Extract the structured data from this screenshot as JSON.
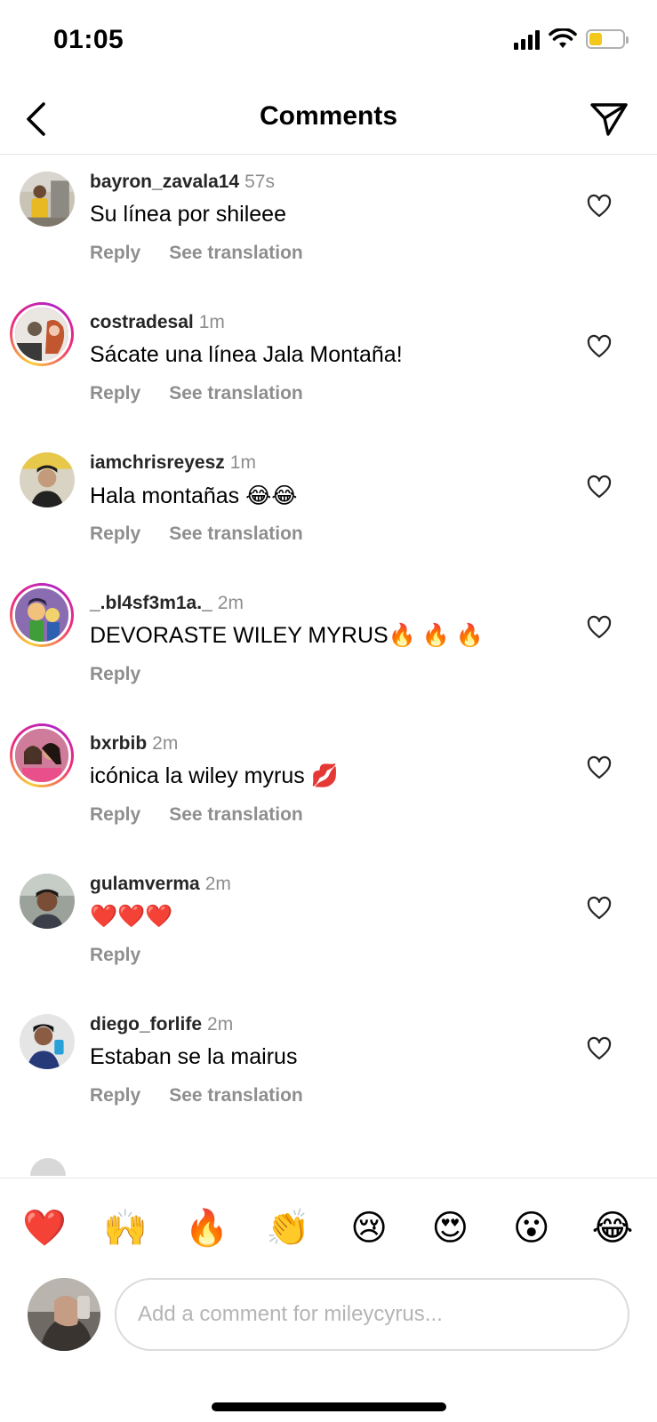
{
  "status_bar": {
    "time": "01:05",
    "battery_color": "#f4c71b",
    "battery_level": 0.4
  },
  "header": {
    "title": "Comments",
    "back_icon": "chevron-left-icon",
    "send_icon": "paper-plane-icon"
  },
  "comments": [
    {
      "username": "bayron_zavala14",
      "time": "57s",
      "text": "Su línea por shileee",
      "reply": "Reply",
      "translate": "See translation",
      "story_ring": false
    },
    {
      "username": "costradesal",
      "time": "1m",
      "text": "Sácate una línea Jala Montaña!",
      "reply": "Reply",
      "translate": "See translation",
      "story_ring": true
    },
    {
      "username": "iamchrisreyesz",
      "time": "1m",
      "text": "Hala montañas 😂😂",
      "reply": "Reply",
      "translate": "See translation",
      "story_ring": false
    },
    {
      "username": "_.bl4sf3m1a._",
      "time": "2m",
      "text": "DEVORASTE WILEY MYRUS🔥 🔥 🔥",
      "reply": "Reply",
      "translate": "",
      "story_ring": true
    },
    {
      "username": "bxrbib",
      "time": "2m",
      "text": "icónica la wiley myrus 💋",
      "reply": "Reply",
      "translate": "See translation",
      "story_ring": true
    },
    {
      "username": "gulamverma",
      "time": "2m",
      "text": "❤️❤️❤️",
      "reply": "Reply",
      "translate": "",
      "story_ring": false
    },
    {
      "username": "diego_forlife",
      "time": "2m",
      "text": "Estaban se la mairus",
      "reply": "Reply",
      "translate": "See translation",
      "story_ring": false
    }
  ],
  "emoji_bar": [
    "❤️",
    "🙌",
    "🔥",
    "👏",
    "😢",
    "😍",
    "😮",
    "😂"
  ],
  "composer": {
    "placeholder": "Add a comment for mileycyrus..."
  },
  "colors": {
    "muted_text": "#8e8e8e",
    "divider": "#e6e6e6",
    "story_ring_start": "#f9ce34",
    "story_ring_end": "#ee2a7b"
  }
}
